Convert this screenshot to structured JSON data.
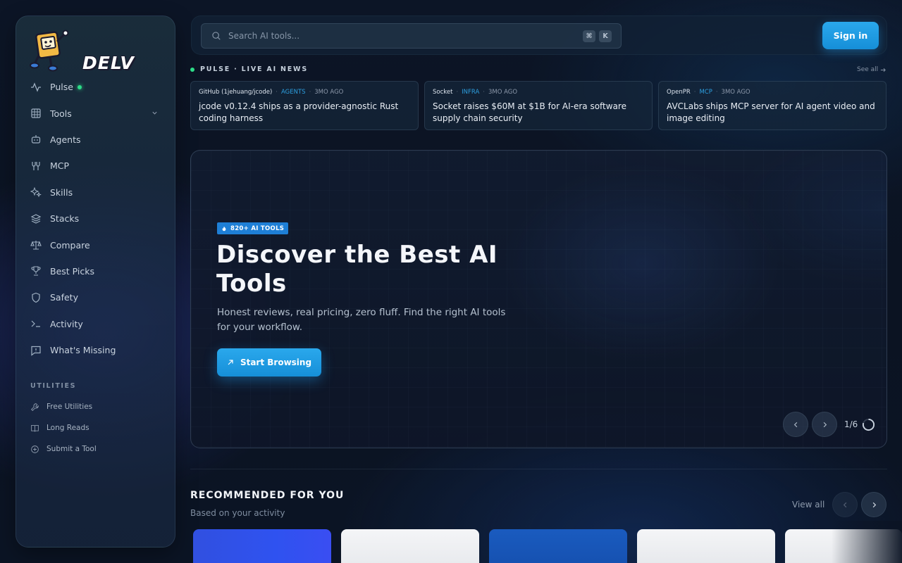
{
  "brand": {
    "name": "DELV"
  },
  "search": {
    "placeholder": "Search AI tools...",
    "shortcut_mod": "⌘",
    "shortcut_key": "K"
  },
  "header": {
    "signin_label": "Sign in"
  },
  "sidebar": {
    "items": [
      {
        "label": "Pulse",
        "icon": "activity-icon"
      },
      {
        "label": "Tools",
        "icon": "grid-icon"
      },
      {
        "label": "Agents",
        "icon": "robot-icon"
      },
      {
        "label": "MCP",
        "icon": "plug-icon"
      },
      {
        "label": "Skills",
        "icon": "sparkles-icon"
      },
      {
        "label": "Stacks",
        "icon": "layers-icon"
      },
      {
        "label": "Compare",
        "icon": "scale-icon"
      },
      {
        "label": "Best Picks",
        "icon": "trophy-icon"
      },
      {
        "label": "Safety",
        "icon": "shield-icon"
      },
      {
        "label": "Activity",
        "icon": "terminal-icon"
      },
      {
        "label": "What's Missing",
        "icon": "message-icon"
      }
    ],
    "utilities_label": "UTILITIES",
    "utilities": [
      {
        "label": "Free Utilities",
        "icon": "wrench-icon"
      },
      {
        "label": "Long Reads",
        "icon": "book-icon"
      },
      {
        "label": "Submit a Tool",
        "icon": "plus-circle-icon"
      }
    ]
  },
  "pulse": {
    "title": "PULSE · LIVE AI NEWS",
    "see_all": "See all",
    "items": [
      {
        "source": "GitHub (1jehuang/jcode)",
        "tag": "AGENTS",
        "time": "3MO AGO",
        "title": "jcode v0.12.4 ships as a provider-agnostic Rust coding harness"
      },
      {
        "source": "Socket",
        "tag": "INFRA",
        "time": "3MO AGO",
        "title": "Socket raises $60M at $1B for AI-era software supply chain security"
      },
      {
        "source": "OpenPR",
        "tag": "MCP",
        "time": "3MO AGO",
        "title": "AVCLabs ships MCP server for AI agent video and image editing"
      }
    ]
  },
  "hero": {
    "badge": "820+ AI TOOLS",
    "title": "Discover the Best AI Tools",
    "subtitle": "Honest reviews, real pricing, zero fluff. Find the right AI tools for your workflow.",
    "cta": "Start Browsing",
    "counter": "1/6"
  },
  "recommended": {
    "title": "RECOMMENDED FOR YOU",
    "subtitle": "Based on your activity",
    "view_all": "View all"
  },
  "colors": {
    "accent": "#1e96e0",
    "live_dot": "#2ddc88",
    "tag": "#2d9fe0"
  }
}
